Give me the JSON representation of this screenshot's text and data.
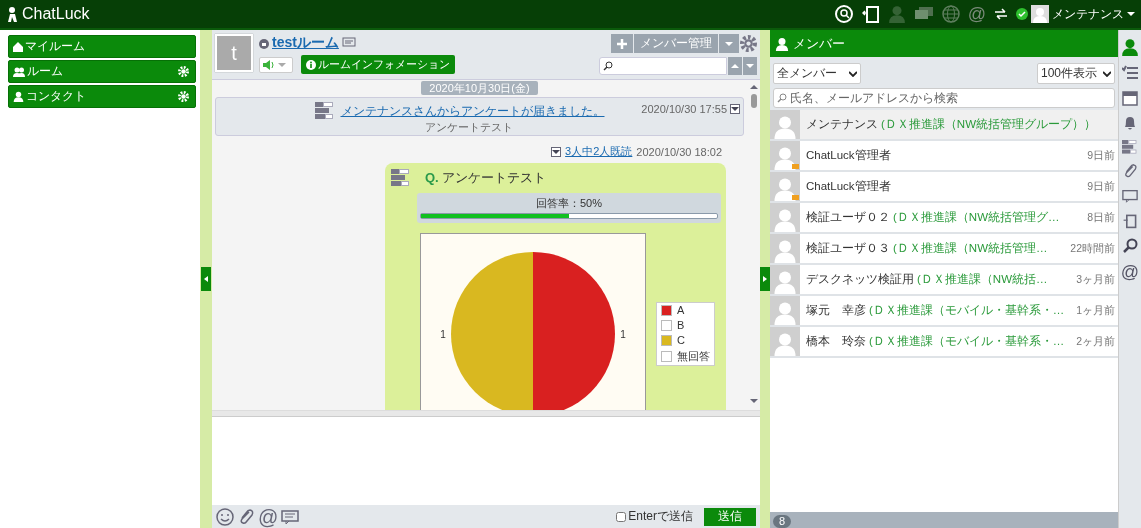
{
  "app": {
    "logo": "ChatLuck"
  },
  "top_bar": {
    "at_icon": "@",
    "user": "メンテナンス",
    "online": true
  },
  "sidebar": {
    "items": [
      {
        "label": "マイルーム",
        "kind": "home",
        "settings": false
      },
      {
        "label": "ルーム",
        "kind": "group",
        "settings": true
      },
      {
        "label": "コンタクト",
        "kind": "person",
        "settings": true
      }
    ]
  },
  "room": {
    "avatar_letter": "t",
    "title": "testルーム",
    "sound_on": true,
    "info_button": "ルームインフォメーション",
    "member_button": "メンバー管理",
    "date_divider": "2020年10月30日(金)"
  },
  "notification": {
    "link": "メンテナンスさんからアンケートが届きました。",
    "subtitle": "アンケートテスト",
    "time": "2020/10/30 17:55"
  },
  "survey_message": {
    "read_status": "3人中2人既読",
    "time": "2020/10/30 18:02",
    "question_mark": "Q.",
    "question": "アンケートテスト",
    "response_rate": "回答率：50%",
    "level": 0.5,
    "chart_data": {
      "type": "pie",
      "categories": [
        "A",
        "B",
        "C",
        "無回答"
      ],
      "values": [
        1,
        0,
        1,
        0
      ],
      "data_labels": true,
      "legend": "right"
    }
  },
  "composer": {
    "enter_to_send_label": "Enterで送信",
    "enter_to_send": false,
    "send_button": "送信",
    "at_icon": "@"
  },
  "members_panel": {
    "title": "メンバー",
    "filter": "全メンバー",
    "page_size": "100件表示",
    "search_placeholder": "氏名、メールアドレスから検索",
    "count": "8",
    "members": [
      {
        "name": "メンテナンス",
        "dept": "(ＤＸ推進課（NW統括管理グループ））",
        "selected": true,
        "badge": false
      },
      {
        "name": "ChatLuck管理者",
        "time": "9日前",
        "selected": false,
        "badge": true
      },
      {
        "name": "ChatLuck管理者",
        "time": "9日前",
        "selected": false,
        "badge": true
      },
      {
        "name": "検証ユーザ０２",
        "dept": "(ＤＸ推進課（NW統括管理グ…",
        "time": "8日前",
        "selected": false,
        "badge": false
      },
      {
        "name": "検証ユーザ０３",
        "dept": "(ＤＸ推進課（NW統括管理…",
        "time": "22時間前",
        "selected": false,
        "badge": false
      },
      {
        "name": "デスクネッツ検証用",
        "dept": "(ＤＸ推進課（NW統括…",
        "time": "3ヶ月前",
        "selected": false,
        "badge": false
      },
      {
        "name": "塚元　幸彦",
        "dept": "(ＤＸ推進課（モバイル・基幹系・…",
        "time": "1ヶ月前",
        "selected": false,
        "badge": false
      },
      {
        "name": "橋本　玲奈",
        "dept": "(ＤＸ推進課（モバイル・基幹系・…",
        "time": "2ヶ月前",
        "selected": false,
        "badge": false
      }
    ]
  },
  "side_icons": {
    "at_icon": "@"
  }
}
